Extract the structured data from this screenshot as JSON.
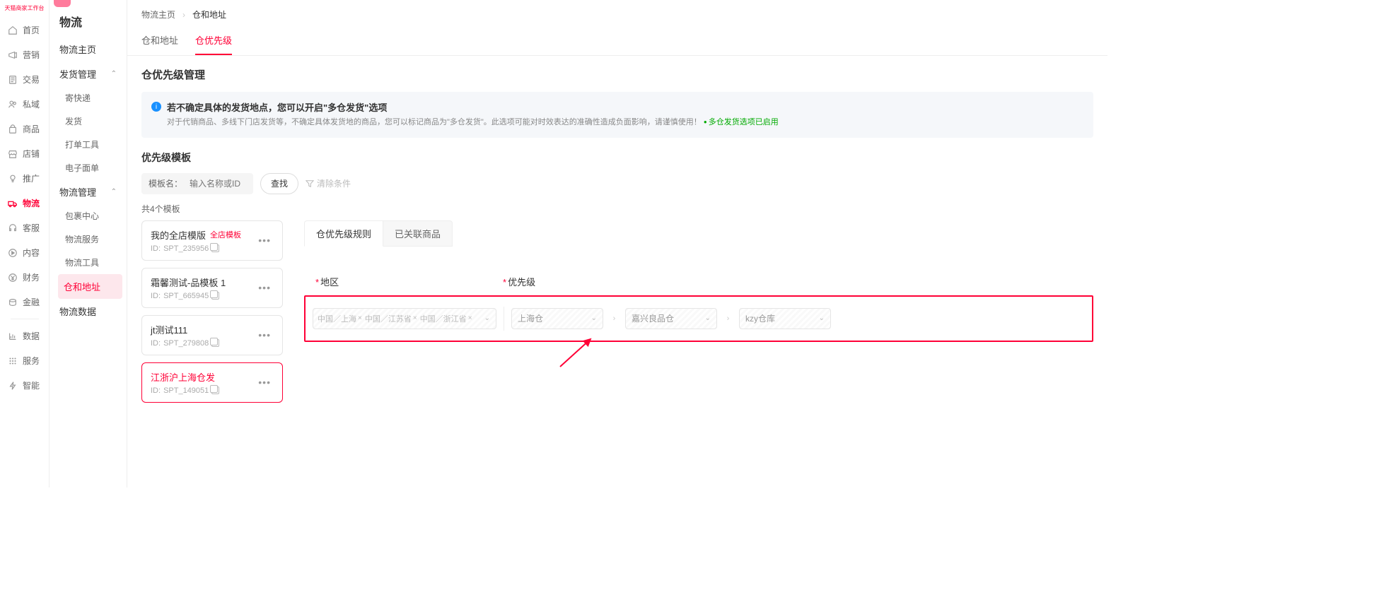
{
  "brand": {
    "subtitle": "天猫商家工作台"
  },
  "nav_rail": {
    "items": [
      {
        "id": "home",
        "label": "首页"
      },
      {
        "id": "marketing",
        "label": "营销"
      },
      {
        "id": "trade",
        "label": "交易"
      },
      {
        "id": "private",
        "label": "私域"
      },
      {
        "id": "goods",
        "label": "商品"
      },
      {
        "id": "shop",
        "label": "店铺"
      },
      {
        "id": "promo",
        "label": "推广"
      },
      {
        "id": "logistics",
        "label": "物流",
        "active": true
      },
      {
        "id": "service",
        "label": "客服"
      },
      {
        "id": "content",
        "label": "内容"
      },
      {
        "id": "finance",
        "label": "财务"
      },
      {
        "id": "funding",
        "label": "金融"
      }
    ],
    "bottom": [
      {
        "id": "data",
        "label": "数据"
      },
      {
        "id": "services",
        "label": "服务"
      },
      {
        "id": "smart",
        "label": "智能"
      }
    ]
  },
  "sidebar": {
    "title": "物流",
    "groups": [
      {
        "type": "item",
        "label": "物流主页"
      },
      {
        "type": "header",
        "label": "发货管理",
        "expanded": true,
        "children": [
          "寄快递",
          "发货",
          "打单工具",
          "电子面单"
        ]
      },
      {
        "type": "header",
        "label": "物流管理",
        "expanded": true,
        "children": [
          "包裹中心",
          "物流服务",
          "物流工具",
          {
            "label": "仓和地址",
            "active": true
          }
        ]
      },
      {
        "type": "item",
        "label": "物流数据"
      }
    ]
  },
  "breadcrumb": {
    "items": [
      "物流主页",
      "仓和地址"
    ]
  },
  "tabs": {
    "items": [
      "仓和地址",
      "仓优先级"
    ],
    "active": 1
  },
  "page_title": "仓优先级管理",
  "alert": {
    "title": "若不确定具体的发货地点，您可以开启\"多仓发货\"选项",
    "desc": "对于代销商品、多线下门店发货等，不确定具体发货地的商品，您可以标记商品为\"多仓发货\"。此选项可能对时效表达的准确性造成负面影响，请谨慎使用！",
    "link": "多仓发货选项已启用"
  },
  "template_filter": {
    "section_title": "优先级模板",
    "label": "模板名：",
    "placeholder": "输入名称或ID",
    "search_btn": "查找",
    "clear": "清除条件"
  },
  "templates": {
    "count_text": "共4个模板",
    "items": [
      {
        "name": "我的全店模版",
        "badge": "全店模板",
        "id_prefix": "ID: ",
        "id": "SPT_235956"
      },
      {
        "name": "霜馨测试-品模板 1",
        "id_prefix": "ID: ",
        "id": "SPT_665945"
      },
      {
        "name": "jt测试111",
        "id_prefix": "ID: ",
        "id": "SPT_279808"
      },
      {
        "name": "江浙沪上海仓发",
        "id_prefix": "ID: ",
        "id": "SPT_149051",
        "selected": true
      }
    ]
  },
  "detail_tabs": {
    "items": [
      "仓优先级规则",
      "已关联商品"
    ],
    "active": 0
  },
  "rule": {
    "headers": {
      "region": "地区",
      "priority": "优先级"
    },
    "region_tags": [
      "中国／上海",
      "中国／江苏省",
      "中国／浙江省"
    ],
    "priority_chain": [
      "上海仓",
      "嘉兴良品仓",
      "kzy仓库"
    ]
  }
}
